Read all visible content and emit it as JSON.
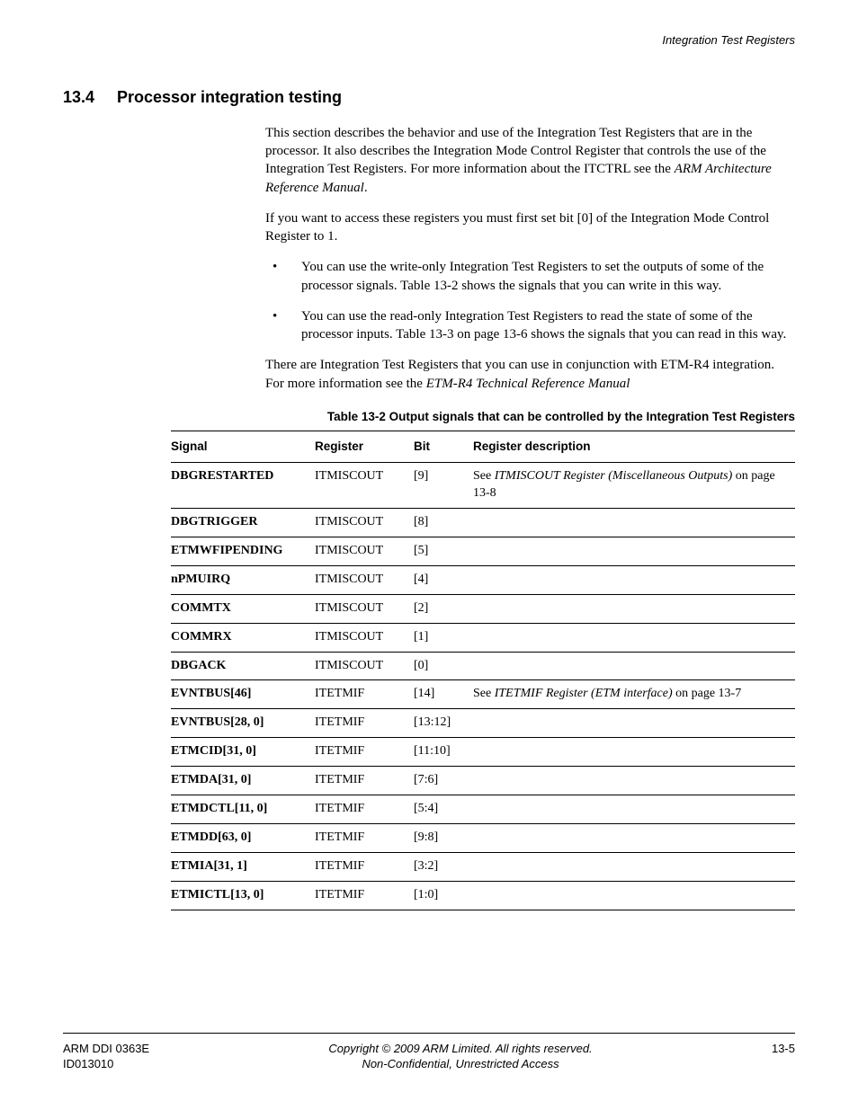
{
  "running_head": "Integration Test Registers",
  "section": {
    "number": "13.4",
    "title": "Processor integration testing"
  },
  "paragraphs": {
    "p1_a": "This section describes the behavior and use of the Integration Test Registers that are in the processor. It also describes the Integration Mode Control Register that controls the use of the Integration Test Registers. For more information about the ITCTRL see the ",
    "p1_ref": "ARM Architecture Reference Manual",
    "p1_b": ".",
    "p2": "If you want to access these registers you must first set bit [0] of the Integration Mode Control Register to 1.",
    "b1": "You can use the write-only Integration Test Registers to set the outputs of some of the processor signals. Table 13-2 shows the signals that you can write in this way.",
    "b2": "You can use the read-only Integration Test Registers to read the state of some of the processor inputs. Table 13-3 on page 13-6 shows the signals that you can read in this way.",
    "p3_a": "There are Integration Test Registers that you can use in conjunction with ETM-R4 integration. For more information see the ",
    "p3_ref": "ETM-R4 Technical Reference Manual"
  },
  "table": {
    "caption": "Table 13-2 Output signals that can be controlled by the Integration Test Registers",
    "headers": {
      "c1": "Signal",
      "c2": "Register",
      "c3": "Bit",
      "c4": "Register description"
    },
    "rows": [
      {
        "signal": "DBGRESTARTED",
        "reg": "ITMISCOUT",
        "bit": "[9]",
        "desc_a": "See ",
        "desc_i": "ITMISCOUT Register (Miscellaneous Outputs)",
        "desc_b": " on page 13-8"
      },
      {
        "signal": "DBGTRIGGER",
        "reg": "ITMISCOUT",
        "bit": "[8]"
      },
      {
        "signal": "ETMWFIPENDING",
        "reg": "ITMISCOUT",
        "bit": "[5]"
      },
      {
        "signal": "nPMUIRQ",
        "reg": "ITMISCOUT",
        "bit": "[4]"
      },
      {
        "signal": "COMMTX",
        "reg": "ITMISCOUT",
        "bit": "[2]"
      },
      {
        "signal": "COMMRX",
        "reg": "ITMISCOUT",
        "bit": "[1]"
      },
      {
        "signal": "DBGACK",
        "reg": "ITMISCOUT",
        "bit": "[0]"
      },
      {
        "signal": "EVNTBUS[46]",
        "reg": "ITETMIF",
        "bit": "[14]",
        "desc_a": "See ",
        "desc_i": "ITETMIF Register (ETM interface)",
        "desc_b": " on page 13-7"
      },
      {
        "signal": "EVNTBUS[28, 0]",
        "reg": "ITETMIF",
        "bit": "[13:12]"
      },
      {
        "signal": "ETMCID[31, 0]",
        "reg": "ITETMIF",
        "bit": "[11:10]"
      },
      {
        "signal": "ETMDA[31, 0]",
        "reg": "ITETMIF",
        "bit": "[7:6]"
      },
      {
        "signal": "ETMDCTL[11, 0]",
        "reg": "ITETMIF",
        "bit": "[5:4]"
      },
      {
        "signal": "ETMDD[63, 0]",
        "reg": "ITETMIF",
        "bit": "[9:8]"
      },
      {
        "signal": "ETMIA[31, 1]",
        "reg": "ITETMIF",
        "bit": "[3:2]"
      },
      {
        "signal": "ETMICTL[13, 0]",
        "reg": "ITETMIF",
        "bit": "[1:0]"
      }
    ]
  },
  "footer": {
    "left1": "ARM DDI 0363E",
    "left2": "ID013010",
    "center1": "Copyright © 2009 ARM Limited. All rights reserved.",
    "center2": "Non-Confidential, Unrestricted Access",
    "right": "13-5"
  }
}
